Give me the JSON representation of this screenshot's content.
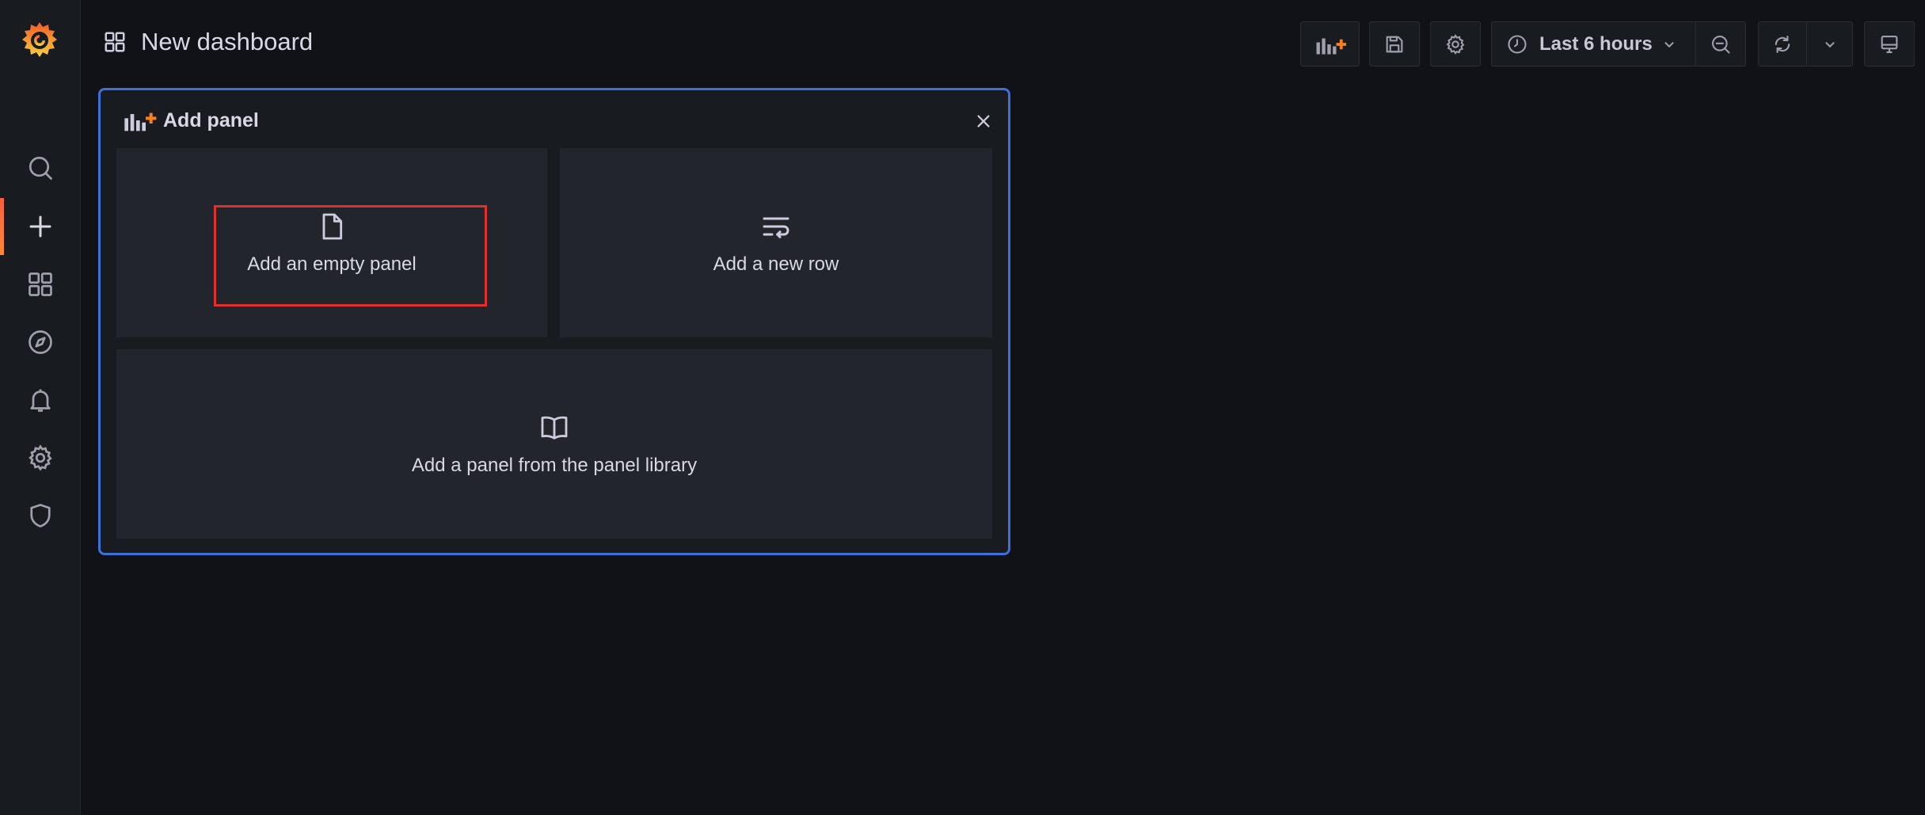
{
  "header": {
    "title": "New dashboard",
    "time_range": "Last 6 hours"
  },
  "sidebar": {
    "items": [
      {
        "name": "search",
        "icon": "search-icon"
      },
      {
        "name": "create",
        "icon": "plus-icon",
        "active": true
      },
      {
        "name": "dashboards",
        "icon": "apps-icon"
      },
      {
        "name": "explore",
        "icon": "compass-icon"
      },
      {
        "name": "alerting",
        "icon": "bell-icon"
      },
      {
        "name": "configuration",
        "icon": "gear-icon"
      },
      {
        "name": "server-admin",
        "icon": "shield-icon"
      }
    ]
  },
  "add_panel": {
    "title": "Add panel",
    "empty_panel_label": "Add an empty panel",
    "new_row_label": "Add a new row",
    "library_label": "Add a panel from the panel library"
  },
  "colors": {
    "background": "#111217",
    "sidebar": "#181b1f",
    "tile": "#22252b",
    "accent_blue": "#3d71d9",
    "highlight_red": "#e02f2f",
    "brand_orange": "#f5821f"
  }
}
